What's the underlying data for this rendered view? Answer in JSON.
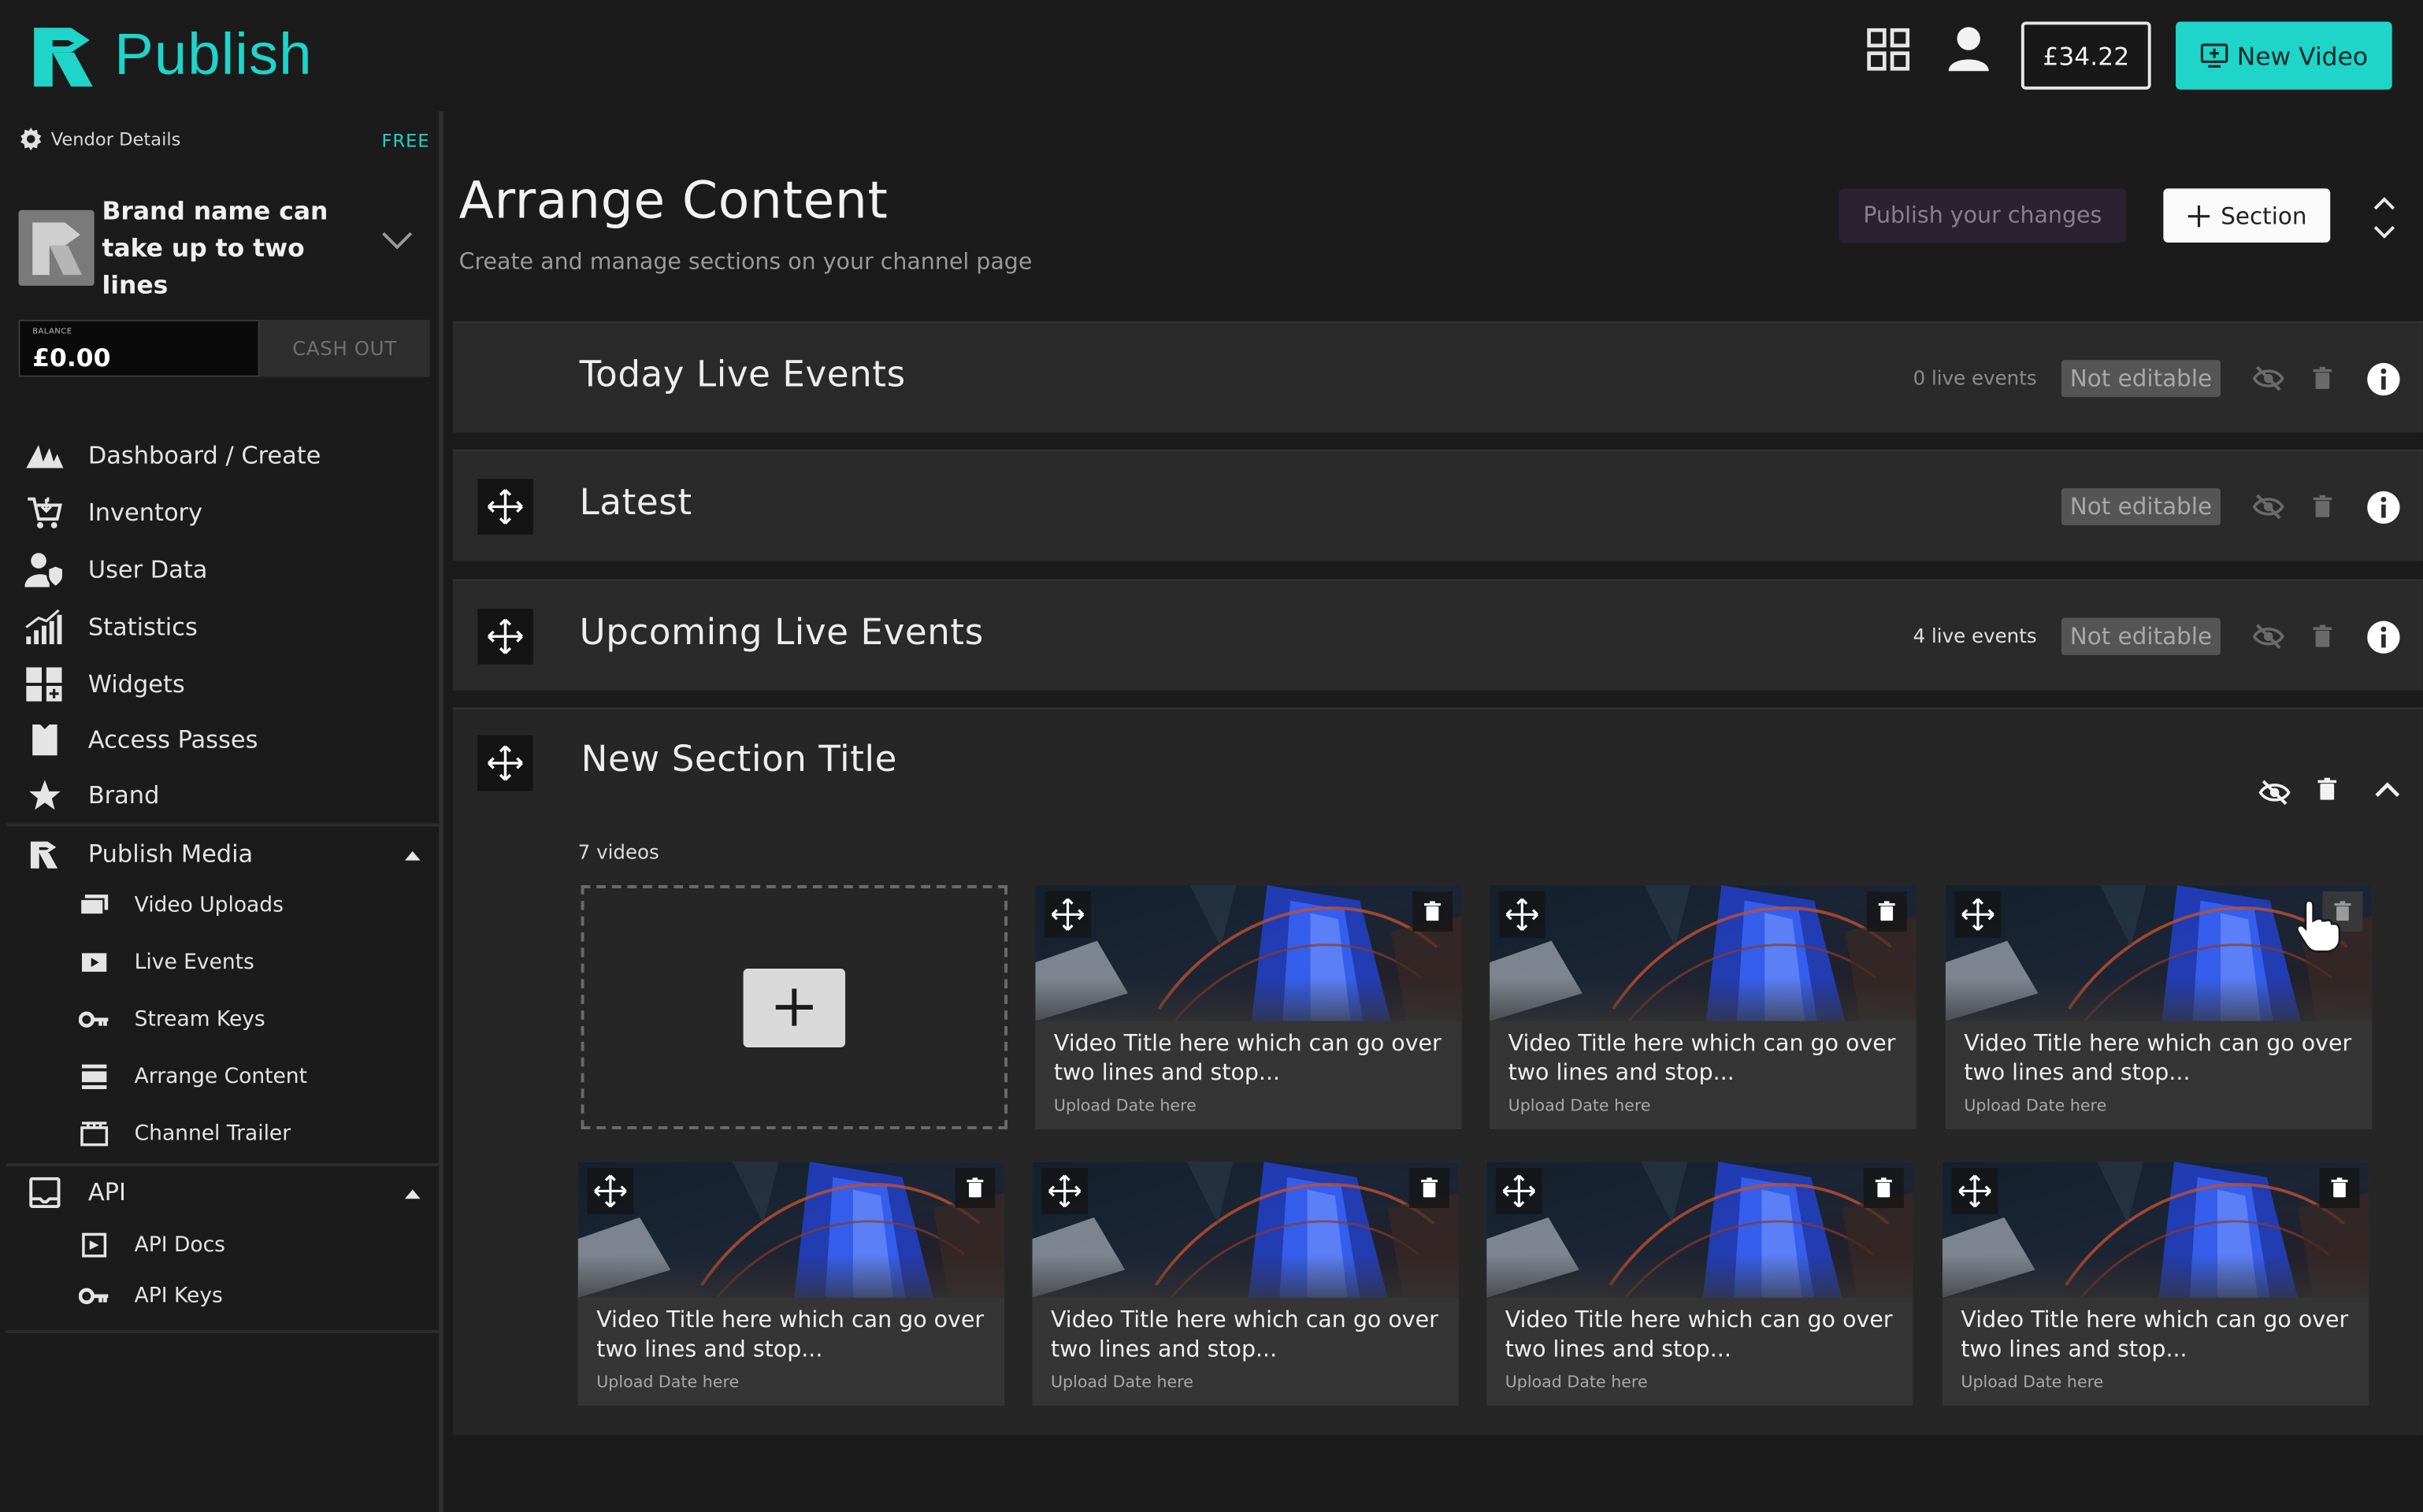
{
  "header": {
    "logo_text": "Publish",
    "balance_button": "£34.22",
    "new_video_button": "New Video",
    "accent_color": "#1fd4c8"
  },
  "sidebar": {
    "vendor_label": "Vendor Details",
    "plan_badge": "FREE",
    "brand_name": "Brand name can take up to two lines",
    "balance_label": "BALANCE",
    "balance_value": "£0.00",
    "cashout_label": "CASH OUT",
    "nav": [
      {
        "label": "Dashboard / Create",
        "icon": "dashboard-icon"
      },
      {
        "label": "Inventory",
        "icon": "cart-icon"
      },
      {
        "label": "User Data",
        "icon": "user-shield-icon"
      },
      {
        "label": "Statistics",
        "icon": "chart-icon"
      },
      {
        "label": "Widgets",
        "icon": "widgets-icon"
      },
      {
        "label": "Access Passes",
        "icon": "pass-icon"
      },
      {
        "label": "Brand",
        "icon": "star-icon"
      }
    ],
    "publish_media": {
      "label": "Publish Media",
      "items": [
        {
          "label": "Video Uploads",
          "icon": "video-uploads-icon"
        },
        {
          "label": "Live Events",
          "icon": "live-icon"
        },
        {
          "label": "Stream Keys",
          "icon": "key-icon"
        },
        {
          "label": "Arrange Content",
          "icon": "arrange-icon"
        },
        {
          "label": "Channel Trailer",
          "icon": "clapper-icon"
        }
      ]
    },
    "api": {
      "label": "API",
      "items": [
        {
          "label": "API Docs",
          "icon": "docs-icon"
        },
        {
          "label": "API Keys",
          "icon": "key-icon"
        }
      ]
    }
  },
  "main": {
    "title": "Arrange Content",
    "subtitle": "Create and manage sections on your channel page",
    "publish_button": "Publish your changes",
    "section_button": "Section",
    "sections": [
      {
        "title": "Today Live Events",
        "count": "0 live events",
        "status": "Not editable"
      },
      {
        "title": "Latest",
        "count": "",
        "status": "Not editable"
      },
      {
        "title": "Upcoming Live Events",
        "count": "4 live events",
        "status": "Not editable"
      }
    ],
    "new_section": {
      "title": "New Section Title",
      "video_count": "7 videos",
      "videos": [
        {
          "title": "Video Title here which can go over two lines and stop...",
          "date": "Upload Date here"
        },
        {
          "title": "Video Title here which can go over two lines and stop...",
          "date": "Upload Date here"
        },
        {
          "title": "Video Title here which can go over two lines and stop...",
          "date": "Upload Date here"
        },
        {
          "title": "Video Title here which can go over two lines and stop...",
          "date": "Upload Date here"
        },
        {
          "title": "Video Title here which can go over two lines and stop...",
          "date": "Upload Date here"
        },
        {
          "title": "Video Title here which can go over two lines and stop...",
          "date": "Upload Date here"
        },
        {
          "title": "Video Title here which can go over two lines and stop...",
          "date": "Upload Date here"
        }
      ]
    }
  }
}
